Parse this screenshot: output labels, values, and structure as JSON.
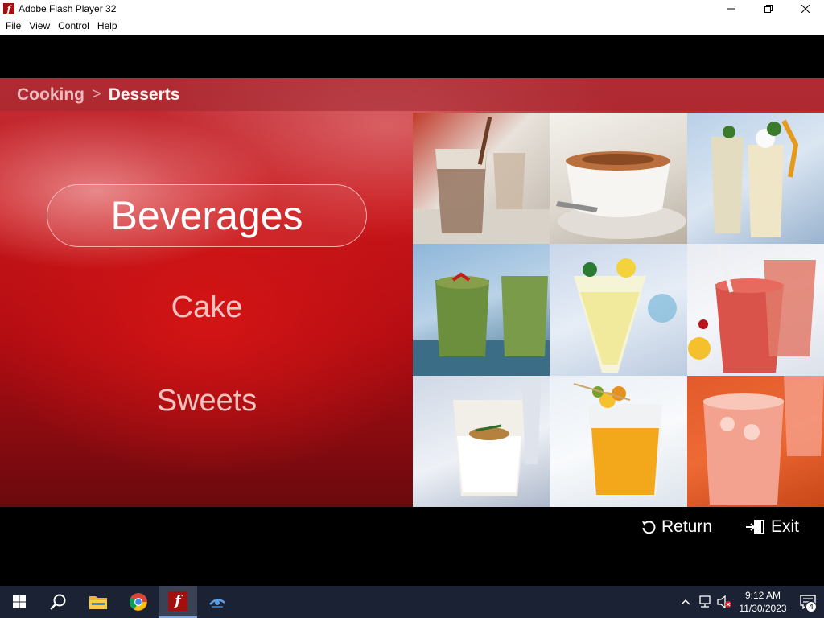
{
  "window": {
    "title": "Adobe Flash Player 32",
    "icon": "flash-player-icon",
    "controls": [
      "minimize-icon",
      "restore-icon",
      "close-icon"
    ]
  },
  "menu": {
    "items": [
      "File",
      "View",
      "Control",
      "Help"
    ]
  },
  "app": {
    "breadcrumb": {
      "parent": "Cooking",
      "separator": ">",
      "current": "Desserts"
    },
    "options": [
      {
        "label": "Beverages",
        "selected": true
      },
      {
        "label": "Cake",
        "selected": false
      },
      {
        "label": "Sweets",
        "selected": false
      }
    ],
    "photos": [
      "hot-chocolate-glass-photo",
      "cappuccino-cup-photo",
      "milkshake-glasses-photo",
      "green-smoothie-photo",
      "lemon-drink-photo",
      "strawberry-smoothie-photo",
      "yogurt-drink-photo",
      "orange-juice-photo",
      "pink-lemonade-photo"
    ],
    "return_label": "Return",
    "exit_label": "Exit"
  },
  "taskbar": {
    "apps": [
      "windows-start-icon",
      "search-icon",
      "file-explorer-icon",
      "chrome-icon",
      "flash-player-icon",
      "app-icon"
    ],
    "time": "9:12 AM",
    "date": "11/30/2023",
    "notification_count": "4"
  },
  "colors": {
    "title_bar": "#ffffff",
    "stage_background": "#000000",
    "accent_red": "#c8161a",
    "taskbar": "#1a2233"
  }
}
